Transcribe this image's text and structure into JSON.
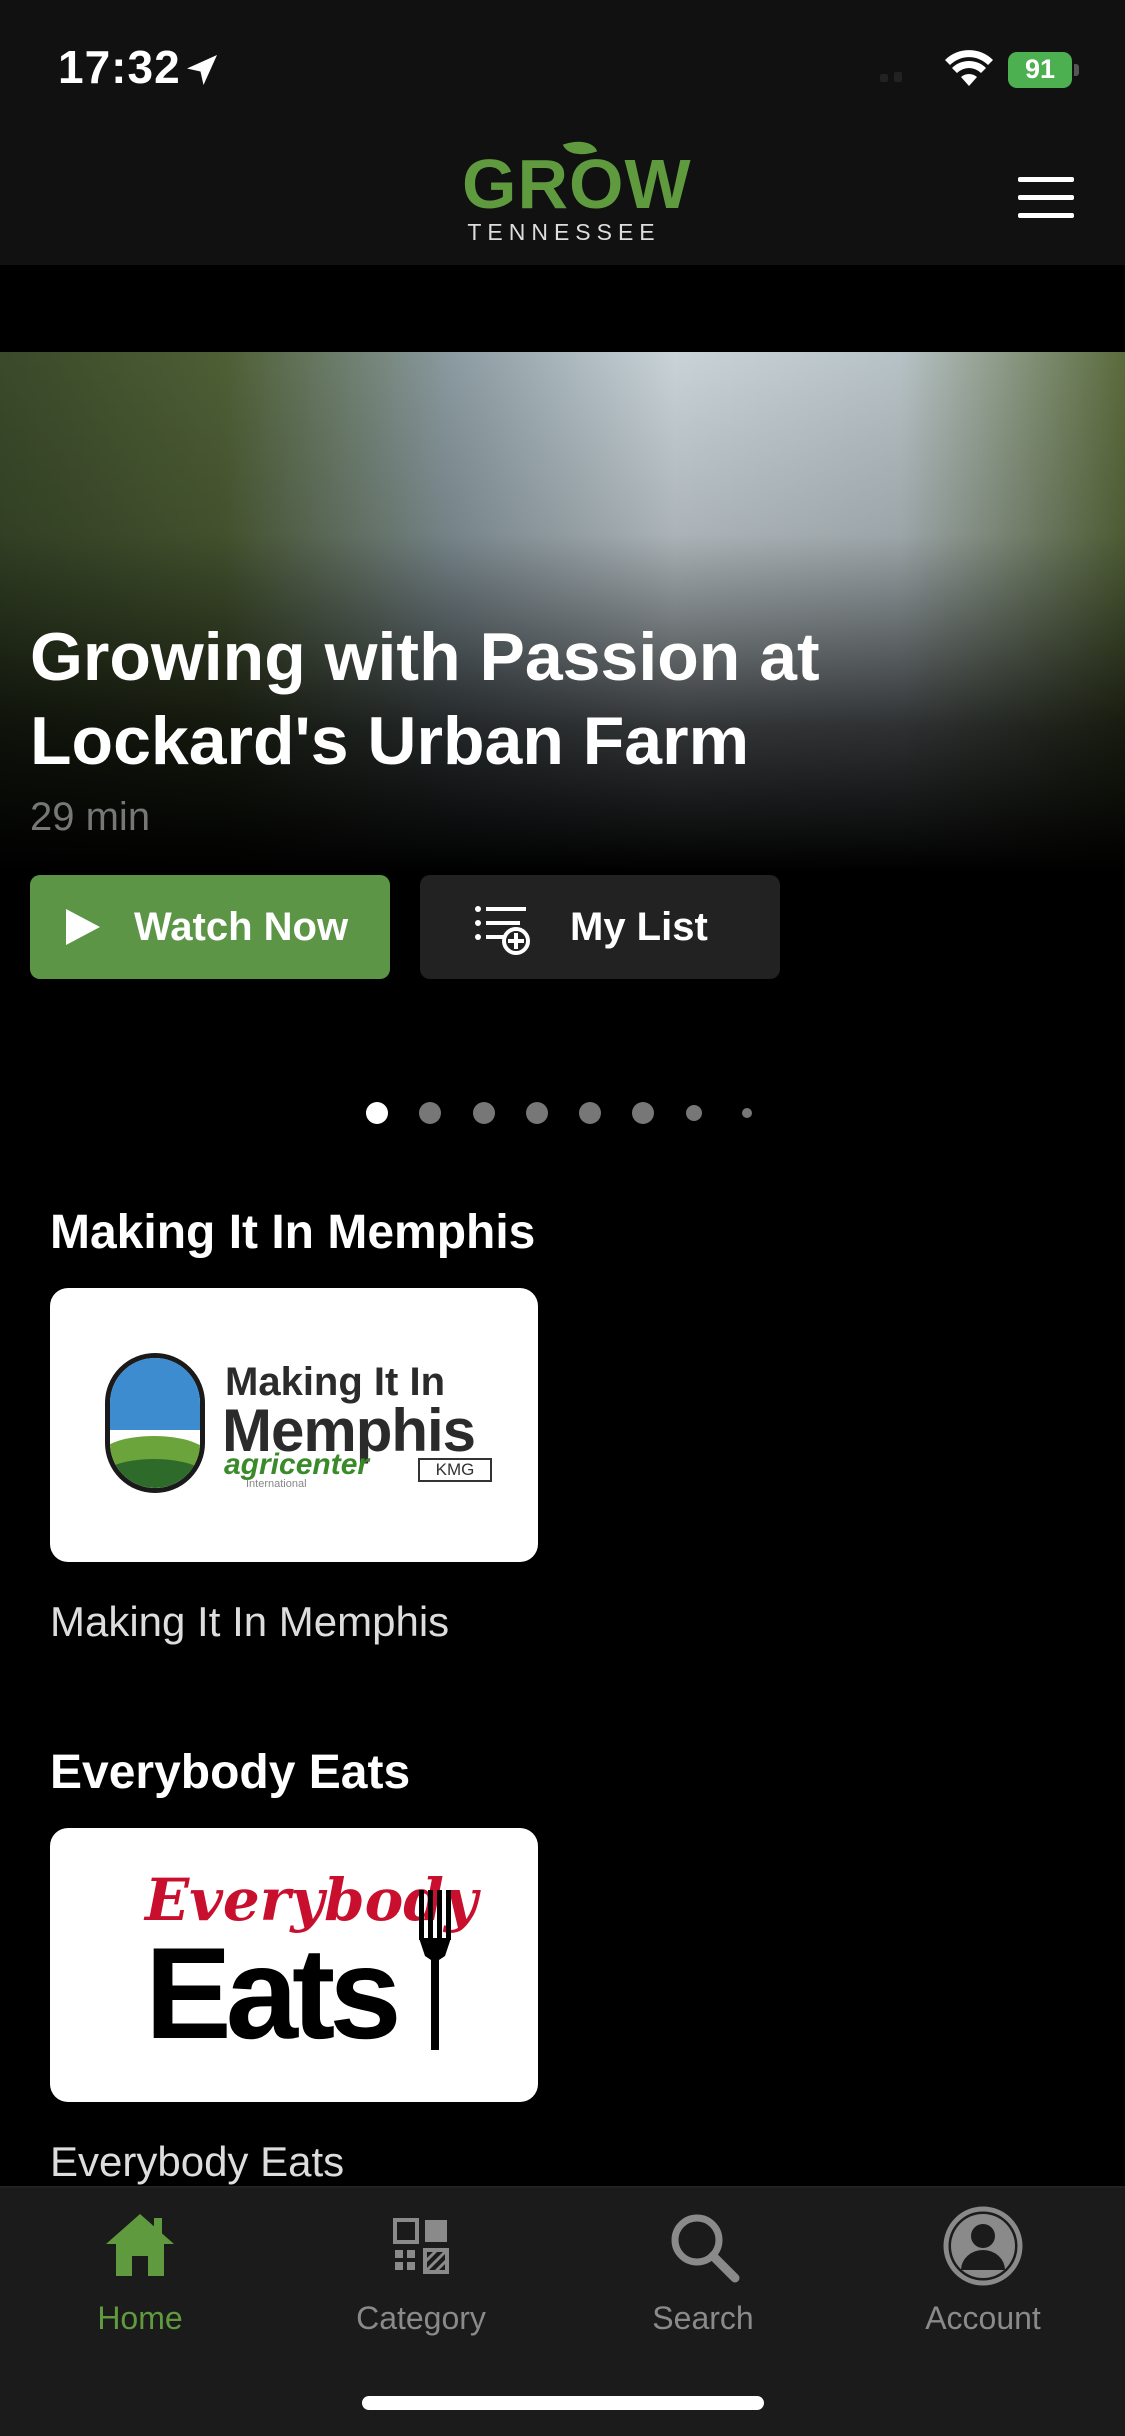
{
  "status_bar": {
    "time": "17:32",
    "battery": "91",
    "icons": [
      "location-arrow-icon",
      "signal-icon",
      "wifi-icon",
      "battery-charging-icon"
    ]
  },
  "header": {
    "logo_main": "GROW",
    "logo_sub": "TENNESSEE",
    "menu_icon": "hamburger-menu-icon"
  },
  "hero": {
    "title": "Growing with Passion at Lockard's Urban Farm",
    "duration": "29 min",
    "watch_label": "Watch Now",
    "list_label": "My List",
    "carousel_total": 8,
    "carousel_active": 1
  },
  "sections": [
    {
      "title": "Making It In Memphis",
      "caption": "Making It In Memphis",
      "logo_lines": [
        "Making It In",
        "Memphis",
        "agricenter",
        "International",
        "KMG"
      ]
    },
    {
      "title": "Everybody Eats",
      "caption": "Everybody Eats",
      "logo_lines": [
        "Everybody",
        "Eats"
      ]
    }
  ],
  "tabs": [
    {
      "label": "Home",
      "icon": "home-icon",
      "active": true
    },
    {
      "label": "Category",
      "icon": "category-grid-icon",
      "active": false
    },
    {
      "label": "Search",
      "icon": "search-icon",
      "active": false
    },
    {
      "label": "Account",
      "icon": "account-icon",
      "active": false
    }
  ],
  "colors": {
    "accent": "#5c9545",
    "background": "#000000",
    "bar": "#111111",
    "inactive_tab": "#8a8a8a"
  }
}
